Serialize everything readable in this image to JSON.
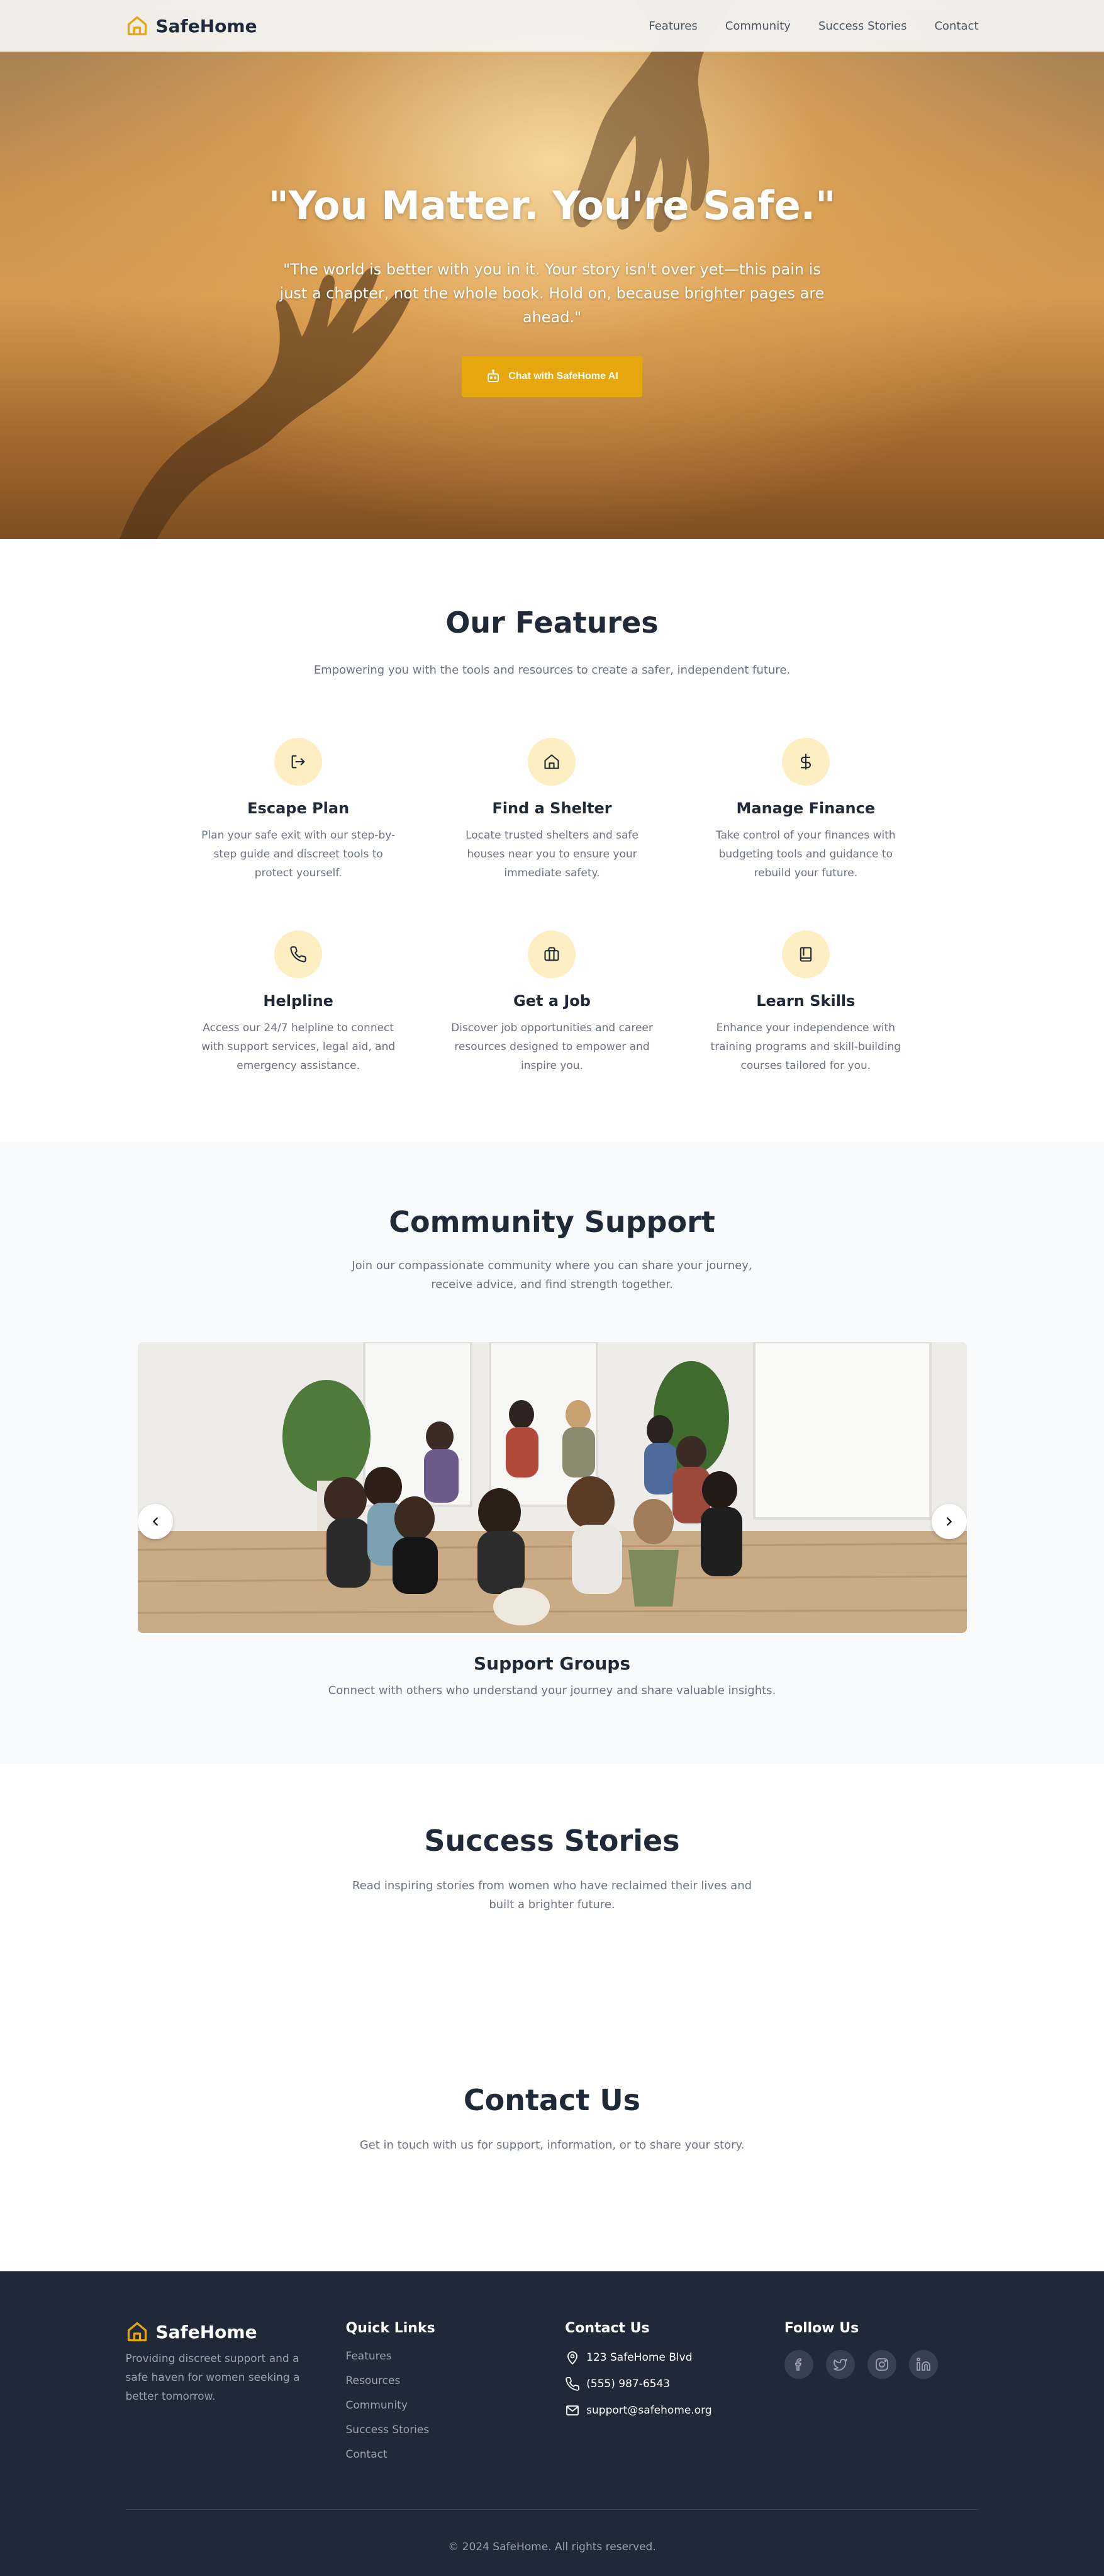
{
  "brand": {
    "name": "SafeHome",
    "icon": "house-icon",
    "accent": "#e6a70e"
  },
  "nav": {
    "items": [
      "Features",
      "Community",
      "Success Stories",
      "Contact"
    ]
  },
  "hero": {
    "title": "\"You Matter. You're Safe.\"",
    "subtitle": "\"The world is better with you in it. Your story isn't over yet—this pain is just a chapter, not the whole book. Hold on, because brighter pages are ahead.\"",
    "cta": "Chat with SafeHome AI",
    "cta_icon": "bot-icon"
  },
  "features": {
    "title": "Our Features",
    "subtitle": "Empowering you with the tools and resources to create a safer, independent future.",
    "items": [
      {
        "title": "Escape Plan",
        "desc": "Plan your safe exit with our step-by-step guide and discreet tools to protect yourself.",
        "icon": "log-out-icon"
      },
      {
        "title": "Find a Shelter",
        "desc": "Locate trusted shelters and safe houses near you to ensure your immediate safety.",
        "icon": "house-icon"
      },
      {
        "title": "Manage Finance",
        "desc": "Take control of your finances with budgeting tools and guidance to rebuild your future.",
        "icon": "dollar-icon"
      },
      {
        "title": "Helpline",
        "desc": "Access our 24/7 helpline to connect with support services, legal aid, and emergency assistance.",
        "icon": "phone-icon"
      },
      {
        "title": "Get a Job",
        "desc": "Discover job opportunities and career resources designed to empower and inspire you.",
        "icon": "briefcase-icon"
      },
      {
        "title": "Learn Skills",
        "desc": "Enhance your independence with training programs and skill-building courses tailored for you.",
        "icon": "book-icon"
      }
    ]
  },
  "community": {
    "title": "Community Support",
    "subtitle": "Join our compassionate community where you can share your journey, receive advice, and find strength together.",
    "slide": {
      "title": "Support Groups",
      "desc": "Connect with others who understand your journey and share valuable insights."
    }
  },
  "stories": {
    "title": "Success Stories",
    "subtitle": "Read inspiring stories from women who have reclaimed their lives and built a brighter future."
  },
  "contact": {
    "title": "Contact Us",
    "subtitle": "Get in touch with us for support, information, or to share your story."
  },
  "footer": {
    "brand": "SafeHome",
    "desc": "Providing discreet support and a safe haven for women seeking a better tomorrow.",
    "quick_links_title": "Quick Links",
    "quick_links": [
      "Features",
      "Resources",
      "Community",
      "Success Stories",
      "Contact"
    ],
    "contact_title": "Contact Us",
    "address": "123 SafeHome Blvd",
    "phone": "(555) 987-6543",
    "email": "support@safehome.org",
    "follow_title": "Follow Us",
    "social": [
      "facebook-icon",
      "twitter-icon",
      "instagram-icon",
      "linkedin-icon"
    ],
    "copyright": "© 2024 SafeHome. All rights reserved."
  }
}
